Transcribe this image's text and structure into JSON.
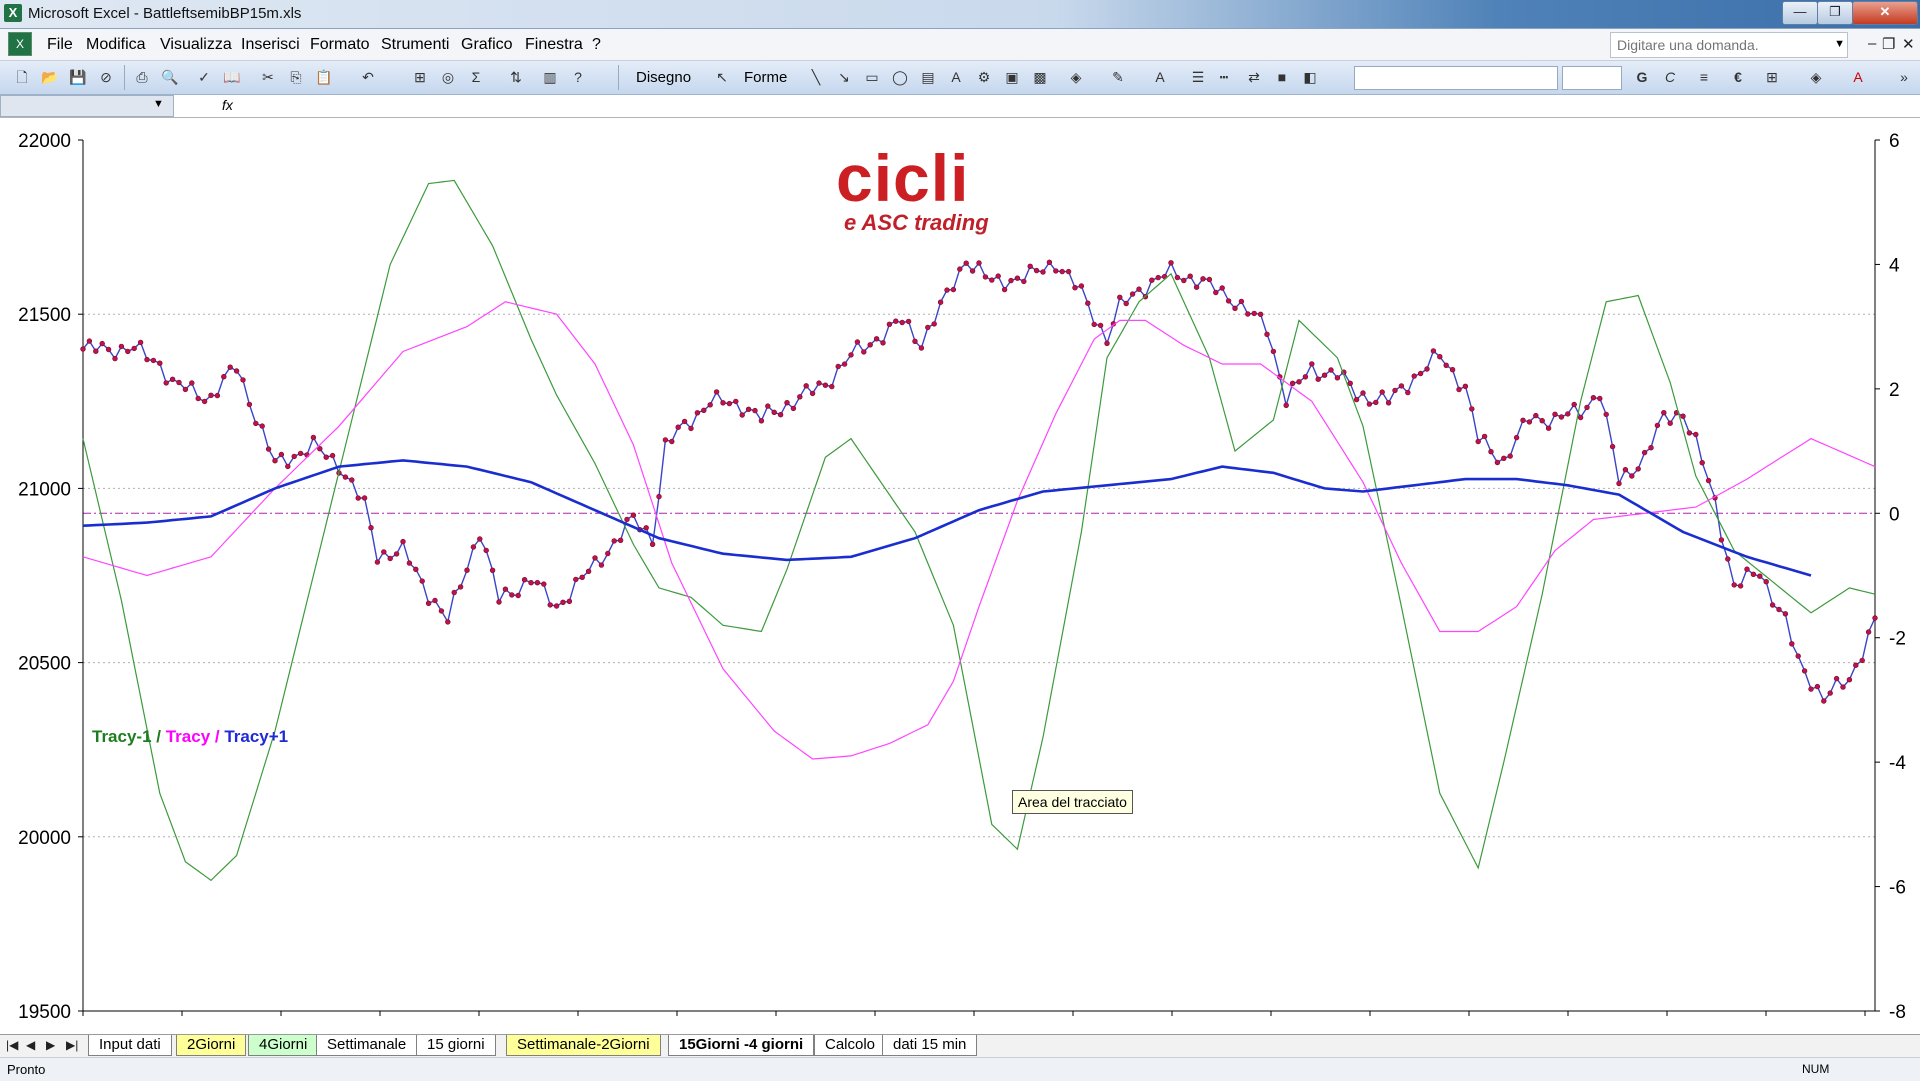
{
  "window": {
    "title": "Microsoft Excel - BattleftsemibBP15m.xls"
  },
  "menu": {
    "items": [
      "File",
      "Modifica",
      "Visualizza",
      "Inserisci",
      "Formato",
      "Strumenti",
      "Grafico",
      "Finestra",
      "?"
    ]
  },
  "help_box": {
    "placeholder": "Digitare una domanda."
  },
  "toolbar": {
    "draw_label": "Disegno",
    "shapes_label": "Forme",
    "bold": "G",
    "italic": "C",
    "euro": "€"
  },
  "formula_bar": {
    "fx": "fx"
  },
  "logo": {
    "main": "cicli",
    "sub": "e ASC trading"
  },
  "legend": {
    "s1": "Tracy-1",
    "sep1": " / ",
    "s2": "Tracy",
    "sep2": " / ",
    "s3": "Tracy+1"
  },
  "tooltip": {
    "text": "Area del tracciato"
  },
  "sheet_tabs": {
    "tabs": [
      {
        "label": "Input dati",
        "style": "white"
      },
      {
        "label": "2Giorni",
        "style": "yellow"
      },
      {
        "label": "4Giorni",
        "style": "green"
      },
      {
        "label": "Settimanale",
        "style": "white"
      },
      {
        "label": "15 giorni",
        "style": "white"
      },
      {
        "label": "Settimanale-2Giorni",
        "style": "yellow"
      },
      {
        "label": "15Giorni -4 giorni",
        "style": "active"
      },
      {
        "label": "Calcolo",
        "style": "white"
      },
      {
        "label": "dati 15 min",
        "style": "white"
      }
    ]
  },
  "status": {
    "text": "Pronto",
    "num": "NUM"
  },
  "colors": {
    "price_line": "#3a44c8",
    "price_marker": "#c0124a",
    "tracy_minus1": "#3c9a3c",
    "tracy": "#ff44ff",
    "tracy_plus1": "#1a2ed0",
    "zero_line": "#aa22aa"
  },
  "chart_data": {
    "type": "line",
    "left_axis": {
      "ylim": [
        19500,
        22000
      ],
      "ticks": [
        "22000",
        "21500",
        "21000",
        "20500",
        "20000",
        "19500"
      ]
    },
    "right_axis": {
      "ylim": [
        -8,
        6
      ],
      "ticks": [
        "6",
        "4",
        "2",
        "0",
        "-2",
        "-4",
        "-6",
        "-8"
      ]
    },
    "x_points": 281,
    "series": [
      {
        "axis": "left",
        "markers": true,
        "knots": [
          [
            0,
            21400
          ],
          [
            8,
            21400
          ],
          [
            12,
            21360
          ],
          [
            14,
            21300
          ],
          [
            20,
            21260
          ],
          [
            24,
            21350
          ],
          [
            28,
            21160
          ],
          [
            30,
            21070
          ],
          [
            36,
            21120
          ],
          [
            40,
            21070
          ],
          [
            44,
            20950
          ],
          [
            46,
            20810
          ],
          [
            50,
            20820
          ],
          [
            54,
            20700
          ],
          [
            57,
            20620
          ],
          [
            62,
            20880
          ],
          [
            65,
            20680
          ],
          [
            70,
            20740
          ],
          [
            74,
            20660
          ],
          [
            80,
            20780
          ],
          [
            86,
            20910
          ],
          [
            89,
            20860
          ],
          [
            91,
            21120
          ],
          [
            94,
            21180
          ],
          [
            98,
            21250
          ],
          [
            103,
            21240
          ],
          [
            106,
            21200
          ],
          [
            110,
            21240
          ],
          [
            116,
            21300
          ],
          [
            120,
            21380
          ],
          [
            128,
            21480
          ],
          [
            131,
            21420
          ],
          [
            135,
            21550
          ],
          [
            138,
            21660
          ],
          [
            142,
            21590
          ],
          [
            148,
            21610
          ],
          [
            152,
            21650
          ],
          [
            156,
            21560
          ],
          [
            160,
            21430
          ],
          [
            162,
            21520
          ],
          [
            165,
            21570
          ],
          [
            170,
            21620
          ],
          [
            174,
            21600
          ],
          [
            180,
            21540
          ],
          [
            185,
            21460
          ],
          [
            188,
            21260
          ],
          [
            192,
            21340
          ],
          [
            196,
            21330
          ],
          [
            199,
            21270
          ],
          [
            204,
            21250
          ],
          [
            208,
            21320
          ],
          [
            212,
            21380
          ],
          [
            216,
            21290
          ],
          [
            218,
            21140
          ],
          [
            222,
            21080
          ],
          [
            226,
            21200
          ],
          [
            230,
            21200
          ],
          [
            234,
            21220
          ],
          [
            237,
            21280
          ],
          [
            240,
            21020
          ],
          [
            244,
            21090
          ],
          [
            247,
            21200
          ],
          [
            250,
            21220
          ],
          [
            252,
            21130
          ],
          [
            255,
            20960
          ],
          [
            258,
            20720
          ],
          [
            262,
            20760
          ],
          [
            266,
            20620
          ],
          [
            268,
            20500
          ],
          [
            272,
            20400
          ],
          [
            276,
            20450
          ],
          [
            280,
            20620
          ]
        ]
      },
      {
        "axis": "right",
        "name": "Tracy-1",
        "knots": [
          [
            0,
            1.2
          ],
          [
            6,
            -1.4
          ],
          [
            12,
            -4.5
          ],
          [
            16,
            -5.6
          ],
          [
            20,
            -5.9
          ],
          [
            24,
            -5.5
          ],
          [
            30,
            -3.5
          ],
          [
            36,
            -1.0
          ],
          [
            42,
            1.5
          ],
          [
            48,
            4.0
          ],
          [
            54,
            5.3
          ],
          [
            58,
            5.35
          ],
          [
            64,
            4.3
          ],
          [
            70,
            2.8
          ],
          [
            74,
            1.9
          ],
          [
            80,
            0.8
          ],
          [
            86,
            -0.5
          ],
          [
            90,
            -1.2
          ],
          [
            95,
            -1.35
          ],
          [
            100,
            -1.8
          ],
          [
            106,
            -1.9
          ],
          [
            110,
            -0.9
          ],
          [
            116,
            0.9
          ],
          [
            120,
            1.2
          ],
          [
            124,
            0.6
          ],
          [
            130,
            -0.3
          ],
          [
            136,
            -1.8
          ],
          [
            142,
            -5.0
          ],
          [
            146,
            -5.4
          ],
          [
            150,
            -3.6
          ],
          [
            156,
            -0.3
          ],
          [
            160,
            2.5
          ],
          [
            165,
            3.4
          ],
          [
            170,
            3.85
          ],
          [
            176,
            2.5
          ],
          [
            180,
            1.0
          ],
          [
            186,
            1.5
          ],
          [
            190,
            3.1
          ],
          [
            196,
            2.5
          ],
          [
            200,
            1.4
          ],
          [
            206,
            -1.5
          ],
          [
            212,
            -4.5
          ],
          [
            218,
            -5.7
          ],
          [
            222,
            -4.0
          ],
          [
            228,
            -1.3
          ],
          [
            234,
            1.8
          ],
          [
            238,
            3.4
          ],
          [
            243,
            3.5
          ],
          [
            248,
            2.1
          ],
          [
            252,
            0.6
          ],
          [
            258,
            -0.6
          ],
          [
            264,
            -1.1
          ],
          [
            270,
            -1.6
          ],
          [
            276,
            -1.2
          ],
          [
            280,
            -1.3
          ]
        ]
      },
      {
        "axis": "right",
        "name": "Tracy",
        "knots": [
          [
            0,
            -0.7
          ],
          [
            10,
            -1.0
          ],
          [
            20,
            -0.7
          ],
          [
            30,
            0.4
          ],
          [
            40,
            1.4
          ],
          [
            50,
            2.6
          ],
          [
            60,
            3.0
          ],
          [
            66,
            3.4
          ],
          [
            74,
            3.2
          ],
          [
            80,
            2.4
          ],
          [
            86,
            1.1
          ],
          [
            92,
            -0.8
          ],
          [
            100,
            -2.5
          ],
          [
            108,
            -3.5
          ],
          [
            114,
            -3.95
          ],
          [
            120,
            -3.9
          ],
          [
            126,
            -3.7
          ],
          [
            132,
            -3.4
          ],
          [
            136,
            -2.7
          ],
          [
            140,
            -1.5
          ],
          [
            146,
            0.2
          ],
          [
            152,
            1.6
          ],
          [
            158,
            2.8
          ],
          [
            162,
            3.1
          ],
          [
            166,
            3.1
          ],
          [
            172,
            2.7
          ],
          [
            178,
            2.4
          ],
          [
            184,
            2.4
          ],
          [
            192,
            1.8
          ],
          [
            200,
            0.5
          ],
          [
            206,
            -0.8
          ],
          [
            212,
            -1.9
          ],
          [
            218,
            -1.9
          ],
          [
            224,
            -1.5
          ],
          [
            230,
            -0.6
          ],
          [
            236,
            -0.1
          ],
          [
            244,
            0.0
          ],
          [
            252,
            0.1
          ],
          [
            260,
            0.55
          ],
          [
            270,
            1.2
          ],
          [
            280,
            0.75
          ]
        ]
      },
      {
        "axis": "right",
        "name": "Tracy+1",
        "knots": [
          [
            0,
            -0.2
          ],
          [
            10,
            -0.15
          ],
          [
            20,
            -0.05
          ],
          [
            30,
            0.4
          ],
          [
            40,
            0.75
          ],
          [
            50,
            0.85
          ],
          [
            60,
            0.75
          ],
          [
            70,
            0.5
          ],
          [
            80,
            0.05
          ],
          [
            90,
            -0.4
          ],
          [
            100,
            -0.65
          ],
          [
            110,
            -0.75
          ],
          [
            120,
            -0.7
          ],
          [
            130,
            -0.4
          ],
          [
            140,
            0.05
          ],
          [
            150,
            0.35
          ],
          [
            160,
            0.45
          ],
          [
            170,
            0.55
          ],
          [
            178,
            0.75
          ],
          [
            186,
            0.65
          ],
          [
            194,
            0.4
          ],
          [
            200,
            0.35
          ],
          [
            208,
            0.45
          ],
          [
            216,
            0.55
          ],
          [
            224,
            0.55
          ],
          [
            232,
            0.45
          ],
          [
            240,
            0.3
          ],
          [
            250,
            -0.3
          ],
          [
            260,
            -0.7
          ],
          [
            270,
            -1.0
          ]
        ]
      }
    ]
  }
}
